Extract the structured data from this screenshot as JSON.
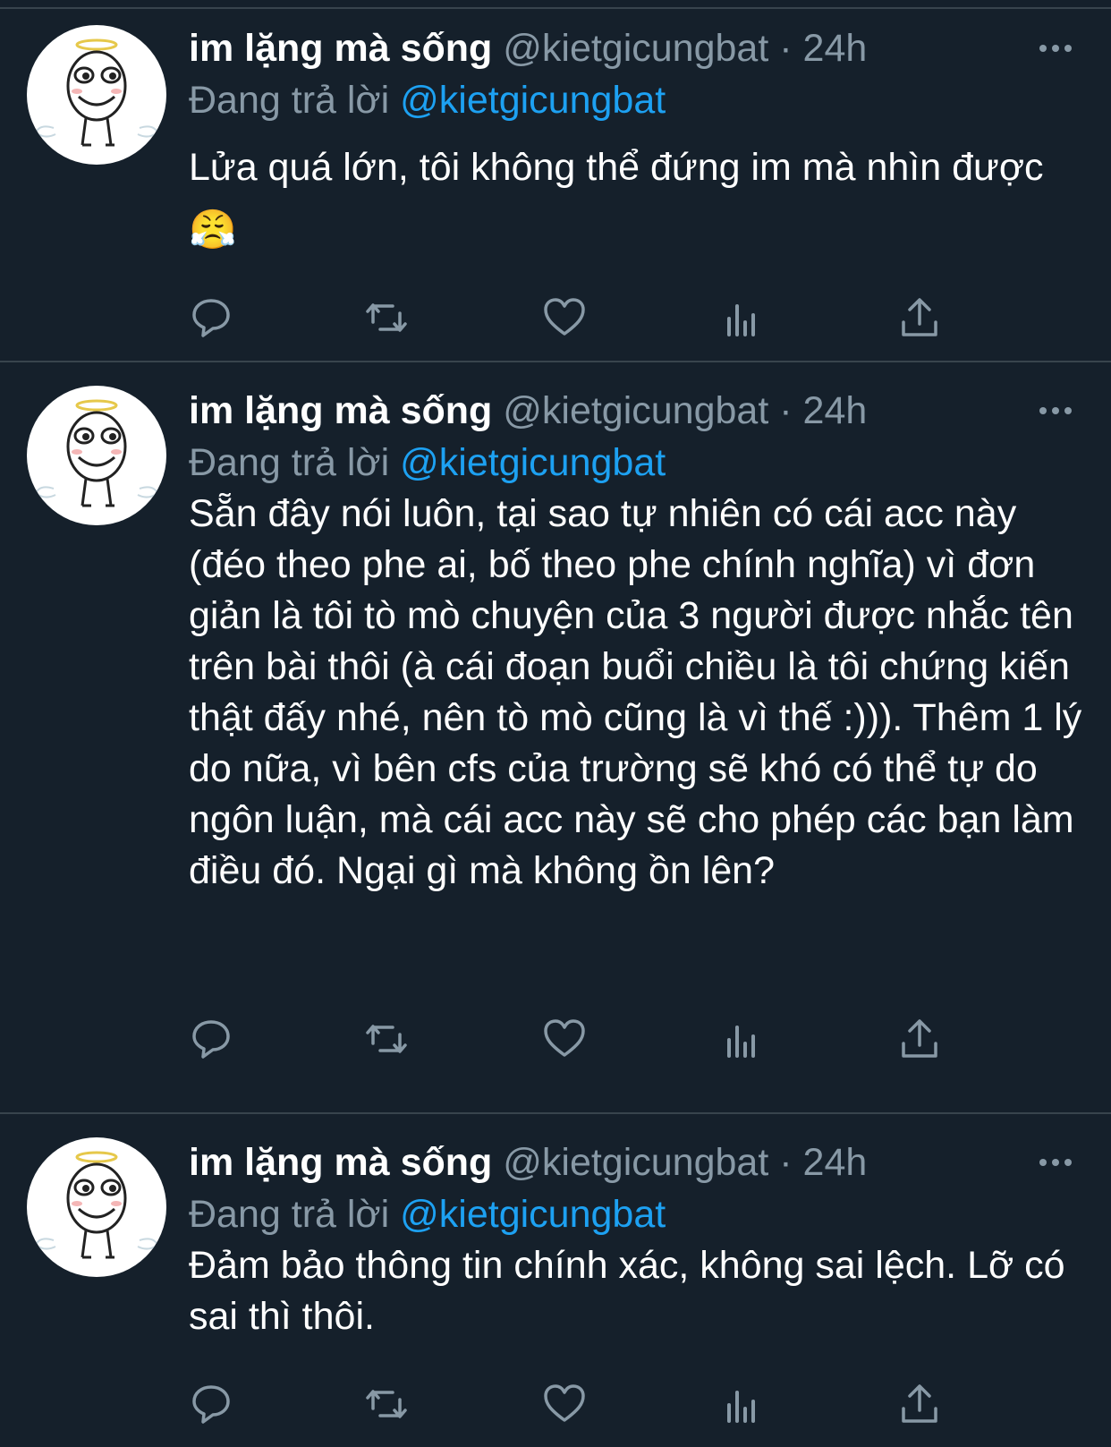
{
  "tweets": [
    {
      "display_name": "im lặng mà sống",
      "handle": "@kietgicungbat",
      "separator": "·",
      "time": "24h",
      "replying_prefix": "Đang trả lời",
      "replying_to": "@kietgicungbat",
      "text": "Lửa quá lớn, tôi không thể đứng im mà nhìn được",
      "emoji": "😤"
    },
    {
      "display_name": "im lặng mà sống",
      "handle": "@kietgicungbat",
      "separator": "·",
      "time": "24h",
      "replying_prefix": "Đang trả lời",
      "replying_to": "@kietgicungbat",
      "text": "Sẵn đây nói luôn, tại sao tự nhiên có cái acc này (đéo theo phe ai, bố theo phe chính nghĩa) vì đơn giản là tôi tò mò chuyện của 3 người được nhắc tên trên bài thôi (à cái đoạn buổi chiều là tôi chứng kiến thật đấy nhé, nên tò mò cũng là vì thế :))). Thêm 1 lý do nữa, vì bên cfs của trường sẽ khó có thể tự do ngôn luận, mà cái acc này sẽ cho phép các bạn làm điều đó. Ngại gì mà không ồn lên?"
    },
    {
      "display_name": "im lặng mà sống",
      "handle": "@kietgicungbat",
      "separator": "·",
      "time": "24h",
      "replying_prefix": "Đang trả lời",
      "replying_to": "@kietgicungbat",
      "text": "Đảm bảo thông tin chính xác, không sai lệch. Lỡ có sai thì thôi."
    }
  ],
  "icons": {
    "avatar": "angel-meme-face-avatar",
    "more": "more-options-icon",
    "reply": "reply-icon",
    "retweet": "retweet-icon",
    "like": "heart-icon",
    "analytics": "analytics-icon",
    "share": "share-icon"
  },
  "colors": {
    "background": "#15202b",
    "divider": "#38444d",
    "secondary_text": "#8899a6",
    "mention": "#1da1f2",
    "icon": "#8899a6"
  }
}
